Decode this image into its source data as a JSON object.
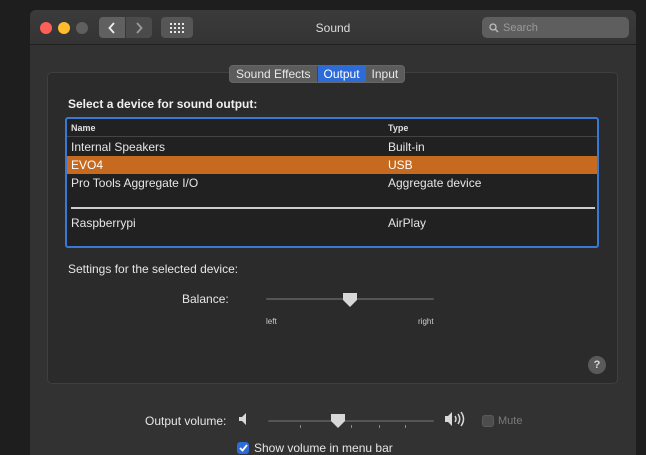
{
  "window": {
    "title": "Sound"
  },
  "toolbar": {
    "search_placeholder": "Search"
  },
  "tabs": [
    {
      "label": "Sound Effects",
      "selected": false
    },
    {
      "label": "Output",
      "selected": true
    },
    {
      "label": "Input",
      "selected": false
    }
  ],
  "output": {
    "select_label": "Select a device for sound output:",
    "columns": {
      "name": "Name",
      "type": "Type"
    },
    "devices": [
      {
        "name": "Internal Speakers",
        "type": "Built-in",
        "selected": false
      },
      {
        "name": "EVO4",
        "type": "USB",
        "selected": true
      },
      {
        "name": "Pro Tools Aggregate I/O",
        "type": "Aggregate device",
        "selected": false
      },
      {
        "name": "Raspberrypi",
        "type": "AirPlay",
        "selected": false
      }
    ],
    "settings_label": "Settings for the selected device:",
    "balance": {
      "label": "Balance:",
      "left": "left",
      "right": "right",
      "value": 0.5
    }
  },
  "help": {
    "label": "?"
  },
  "volume": {
    "label": "Output volume:",
    "value": 0.42,
    "mute_label": "Mute",
    "mute_checked": false
  },
  "menu_bar": {
    "label": "Show volume in menu bar",
    "checked": true
  },
  "colors": {
    "accent": "#2d6bd8",
    "selection": "#c56a1f",
    "list_border": "#3a78d6"
  },
  "icons": [
    "back-arrow-icon",
    "forward-arrow-icon",
    "grid-icon",
    "search-icon",
    "speaker-low-icon",
    "speaker-high-icon",
    "checkmark-icon",
    "help-icon"
  ]
}
